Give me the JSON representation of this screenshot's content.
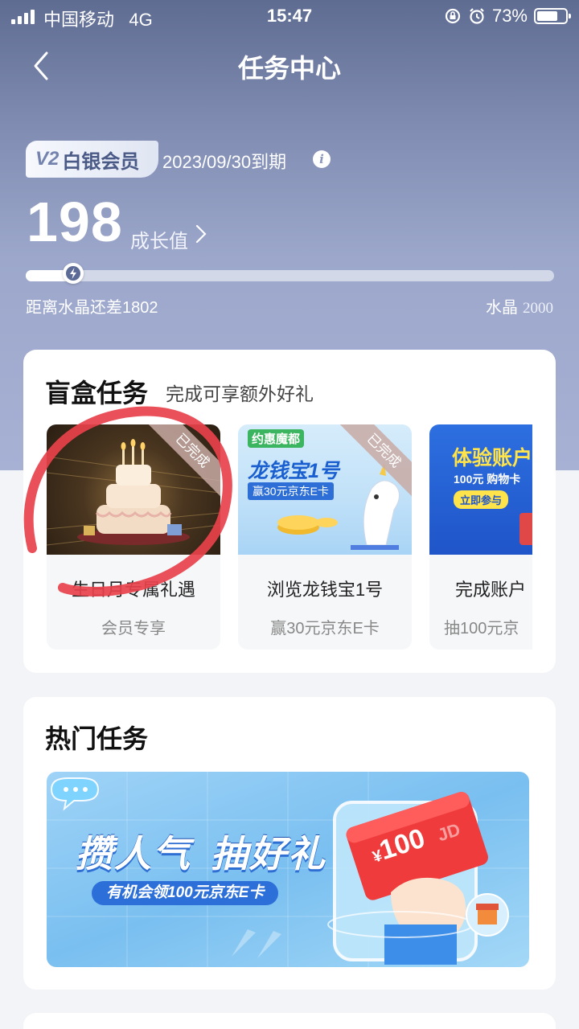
{
  "status_bar": {
    "carrier": "中国移动",
    "network": "4G",
    "time": "15:47",
    "battery_percent": "73%",
    "battery_level": 0.73,
    "icons": [
      "signal-icon",
      "rotation-lock-icon",
      "alarm-icon",
      "battery-icon"
    ]
  },
  "header": {
    "title": "任务中心",
    "back_icon": "chevron-left-icon"
  },
  "membership": {
    "level_badge": "V2",
    "level_name": "白银会员",
    "expire_text": "2023/09/30到期",
    "info_icon": "info-icon"
  },
  "growth": {
    "value": "198",
    "label": "成长值",
    "arrow_icon": "chevron-right-icon"
  },
  "progress": {
    "current": 198,
    "target": 2000,
    "left_text": "距离水晶还差1802",
    "target_label": "水晶",
    "target_value": "2000",
    "knob_icon": "lightning-icon"
  },
  "blind_box": {
    "title": "盲盒任务",
    "subtitle": "完成可享额外好礼",
    "tasks": [
      {
        "name": "生日月专属礼遇",
        "sub": "会员专享",
        "status": "已完成",
        "image": "birthday-cake-image"
      },
      {
        "name": "浏览龙钱宝1号",
        "sub": "赢30元京东E卡",
        "status": "已完成",
        "image": "longqianbao-banner",
        "banner_top": "约惠魔都",
        "banner_title": "龙钱宝1号",
        "banner_sub": "赢30元京东E卡"
      },
      {
        "name": "完成账户",
        "sub": "抽100元京",
        "status": "",
        "image": "account-experience-banner",
        "banner_title": "体验账户",
        "banner_sub": "100元",
        "banner_sub2": "购物卡",
        "banner_btn": "立即参与"
      }
    ]
  },
  "hot_tasks": {
    "title": "热门任务",
    "banner": {
      "headline1": "攒人气",
      "headline2": "抽好礼",
      "tagline": "有机会领100元京东E卡",
      "card_amount": "100",
      "card_currency": "¥",
      "card_brand": "JD"
    }
  },
  "colors": {
    "hero_top": "#5f6c92",
    "hero_bottom": "#a7b1d4",
    "annotation_red": "#e8414b",
    "page_bg": "#f3f4f7"
  }
}
